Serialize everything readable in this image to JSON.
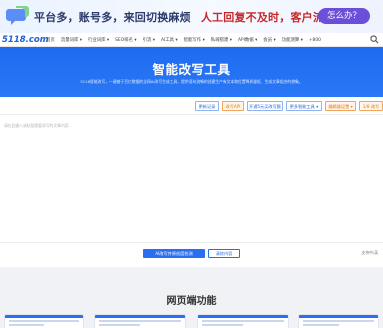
{
  "ad": {
    "text_part1": "平台多，账号多，来回切换麻烦",
    "text_part2": "人工回复不及时，客户流失",
    "button": "怎么办？"
  },
  "nav": {
    "logo": "5118.com",
    "items": [
      "首页",
      "流量词库 ▾",
      "行业词库 ▾",
      "SEO排名 ▾",
      "引流 ▾",
      "AI工具 ▾",
      "智能写作 ▾",
      "私域搭建 ▾",
      "API数据 ▾",
      "会员 ▾",
      "功能测算 ▾",
      "+800"
    ]
  },
  "hero": {
    "title": "智能改写工具",
    "description": "5118智能改写，一键基于百亿数据的全网AI改写生成工具，提供语句流畅的创建生产有文本和位置降质量低、生成文章组合的想象。"
  },
  "toolbar": {
    "buttons": [
      {
        "label": "更新记录",
        "style": "blue"
      },
      {
        "label": "改写API",
        "style": "orange"
      },
      {
        "label": "开通5元买改写额",
        "style": "blue"
      },
      {
        "label": "更多智能工具 ▾",
        "style": "blue"
      },
      {
        "label": "编辑器设置 ▾",
        "style": "orange"
      },
      {
        "label": "1/8 改写",
        "style": "orange"
      }
    ]
  },
  "editor": {
    "placeholder": "请在此输入或粘贴需要改写的文章内容..."
  },
  "actions": {
    "primary": "AI改写并原创度检测",
    "secondary": "清除内容",
    "support": "支持中/英"
  },
  "section": {
    "title": "网页端功能"
  },
  "colors": {
    "hero": "#2a78f5",
    "primary": "#2a6ef2",
    "ad_button": "#6b4fd8",
    "accent_orange": "#e07a1c"
  }
}
